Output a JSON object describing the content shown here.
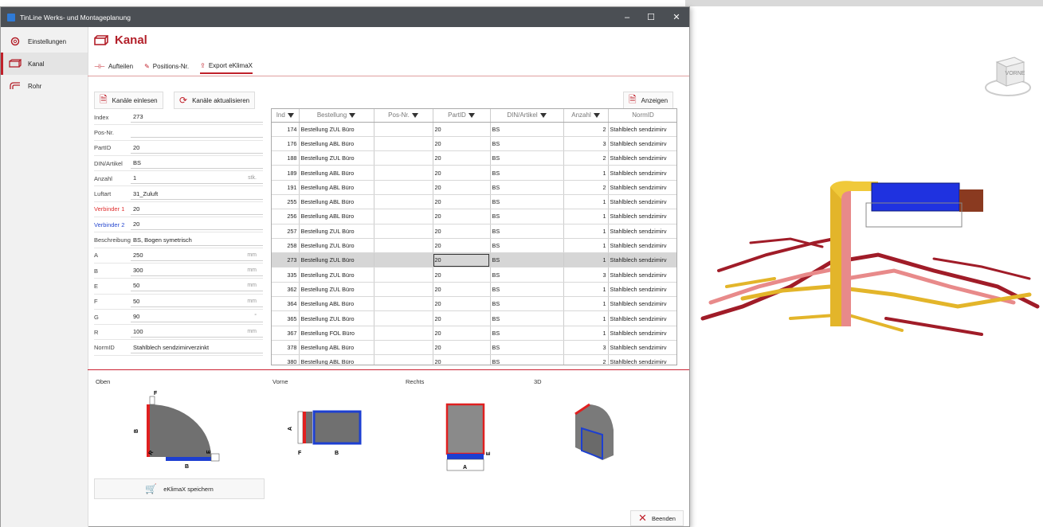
{
  "window": {
    "title": "TinLine Werks- und Montageplanung",
    "min": "–",
    "max": "☐",
    "close": "✕"
  },
  "sidebar": {
    "items": [
      {
        "label": "Einstellungen",
        "icon": "gear-icon"
      },
      {
        "label": "Kanal",
        "icon": "duct-icon"
      },
      {
        "label": "Rohr",
        "icon": "pipe-icon"
      }
    ]
  },
  "header": {
    "title": "Kanal"
  },
  "tabs": [
    {
      "label": "Aufteilen"
    },
    {
      "label": "Positions-Nr."
    },
    {
      "label": "Export eKlimaX"
    }
  ],
  "toolbar": {
    "load": "Kanäle einlesen",
    "refresh": "Kanäle aktualisieren",
    "show": "Anzeigen"
  },
  "form": [
    {
      "label": "Index",
      "value": "273",
      "unit": ""
    },
    {
      "label": "Pos-Nr.",
      "value": "",
      "unit": ""
    },
    {
      "label": "PartID",
      "value": "20",
      "unit": ""
    },
    {
      "label": "DIN/Artikel",
      "value": "BS",
      "unit": ""
    },
    {
      "label": "Anzahl",
      "value": "1",
      "unit": "stk."
    },
    {
      "label": "Luftart",
      "value": "31_Zuluft",
      "unit": ""
    },
    {
      "label": "Verbinder 1",
      "value": "20",
      "unit": "",
      "color": "#e03030"
    },
    {
      "label": "Verbinder 2",
      "value": "20",
      "unit": "",
      "color": "#2a4bd0"
    },
    {
      "label": "Beschreibung",
      "value": "BS, Bogen symetrisch",
      "unit": ""
    },
    {
      "label": "A",
      "value": "250",
      "unit": "mm"
    },
    {
      "label": "B",
      "value": "300",
      "unit": "mm"
    },
    {
      "label": "E",
      "value": "50",
      "unit": "mm"
    },
    {
      "label": "F",
      "value": "50",
      "unit": "mm"
    },
    {
      "label": "G",
      "value": "90",
      "unit": "°"
    },
    {
      "label": "R",
      "value": "100",
      "unit": "mm"
    },
    {
      "label": "NormID",
      "value": "Stahlblech sendzimirverzinkt",
      "unit": ""
    }
  ],
  "grid": {
    "headers": [
      "Ind",
      "Bestellung",
      "Pos-Nr.",
      "PartID",
      "DIN/Artikel",
      "Anzahl",
      "NormID"
    ],
    "rows": [
      [
        "174",
        "Bestellung ZUL Büro",
        "",
        "20",
        "BS",
        "2",
        "Stahlblech sendzimirv"
      ],
      [
        "176",
        "Bestellung ABL Büro",
        "",
        "20",
        "BS",
        "3",
        "Stahlblech sendzimirv"
      ],
      [
        "188",
        "Bestellung ZUL Büro",
        "",
        "20",
        "BS",
        "2",
        "Stahlblech sendzimirv"
      ],
      [
        "189",
        "Bestellung ABL Büro",
        "",
        "20",
        "BS",
        "1",
        "Stahlblech sendzimirv"
      ],
      [
        "191",
        "Bestellung ABL Büro",
        "",
        "20",
        "BS",
        "2",
        "Stahlblech sendzimirv"
      ],
      [
        "255",
        "Bestellung ABL Büro",
        "",
        "20",
        "BS",
        "1",
        "Stahlblech sendzimirv"
      ],
      [
        "256",
        "Bestellung ABL Büro",
        "",
        "20",
        "BS",
        "1",
        "Stahlblech sendzimirv"
      ],
      [
        "257",
        "Bestellung ZUL Büro",
        "",
        "20",
        "BS",
        "1",
        "Stahlblech sendzimirv"
      ],
      [
        "258",
        "Bestellung ZUL Büro",
        "",
        "20",
        "BS",
        "1",
        "Stahlblech sendzimirv"
      ],
      [
        "273",
        "Bestellung ZUL Büro",
        "",
        "20",
        "BS",
        "1",
        "Stahlblech sendzimirv"
      ],
      [
        "335",
        "Bestellung ZUL Büro",
        "",
        "20",
        "BS",
        "3",
        "Stahlblech sendzimirv"
      ],
      [
        "362",
        "Bestellung ZUL Büro",
        "",
        "20",
        "BS",
        "1",
        "Stahlblech sendzimirv"
      ],
      [
        "364",
        "Bestellung ABL Büro",
        "",
        "20",
        "BS",
        "1",
        "Stahlblech sendzimirv"
      ],
      [
        "365",
        "Bestellung ZUL Büro",
        "",
        "20",
        "BS",
        "1",
        "Stahlblech sendzimirv"
      ],
      [
        "367",
        "Bestellung FOL Büro",
        "",
        "20",
        "BS",
        "1",
        "Stahlblech sendzimirv"
      ],
      [
        "378",
        "Bestellung ABL Büro",
        "",
        "20",
        "BS",
        "3",
        "Stahlblech sendzimirv"
      ],
      [
        "380",
        "Bestellung ABL Büro",
        "",
        "20",
        "BS",
        "2",
        "Stahlblech sendzimirv"
      ]
    ],
    "selected_index": "273"
  },
  "views": {
    "top": "Oben",
    "front": "Vorne",
    "right": "Rechts",
    "three_d": "3D"
  },
  "dims": {
    "B": "B",
    "E": "E",
    "F": "F",
    "R": "R",
    "A": "A"
  },
  "save": "eKlimaX speichern",
  "quit": "Beenden",
  "viewcube": "VORNE",
  "colors": {
    "accent": "#c0202a",
    "blue": "#1d3fd1",
    "red": "#e02020"
  }
}
